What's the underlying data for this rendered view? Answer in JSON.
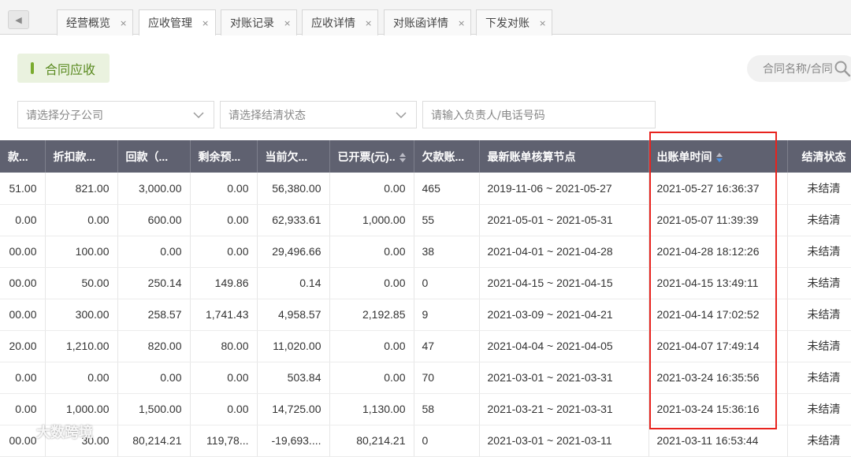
{
  "tabs": [
    {
      "label": "经营概览",
      "close": "×",
      "active": false
    },
    {
      "label": "应收管理",
      "close": "×",
      "active": true
    },
    {
      "label": "对账记录",
      "close": "×",
      "active": false
    },
    {
      "label": "应收详情",
      "close": "×",
      "active": false
    },
    {
      "label": "对账函详情",
      "close": "×",
      "active": false
    },
    {
      "label": "下发对账",
      "close": "×",
      "active": false
    }
  ],
  "section_button": {
    "label": "合同应收"
  },
  "search": {
    "placeholder": "合同名称/合同"
  },
  "filters": {
    "company": "请选择分子公司",
    "status": "请选择结清状态",
    "owner_placeholder": "请输入负责人/电话号码"
  },
  "table": {
    "headers": [
      "款...",
      "折扣款...",
      "回款（...",
      "剩余预...",
      "当前欠...",
      "已开票(元)..",
      "欠款账...",
      "最新账单核算节点",
      "出账单时间",
      "结清状态"
    ],
    "rows": [
      [
        "51.00",
        "821.00",
        "3,000.00",
        "0.00",
        "56,380.00",
        "0.00",
        "465",
        "2019-11-06 ~ 2021-05-27",
        "2021-05-27 16:36:37",
        "未结清"
      ],
      [
        "0.00",
        "0.00",
        "600.00",
        "0.00",
        "62,933.61",
        "1,000.00",
        "55",
        "2021-05-01 ~ 2021-05-31",
        "2021-05-07 11:39:39",
        "未结清"
      ],
      [
        "00.00",
        "100.00",
        "0.00",
        "0.00",
        "29,496.66",
        "0.00",
        "38",
        "2021-04-01 ~ 2021-04-28",
        "2021-04-28 18:12:26",
        "未结清"
      ],
      [
        "00.00",
        "50.00",
        "250.14",
        "149.86",
        "0.14",
        "0.00",
        "0",
        "2021-04-15 ~ 2021-04-15",
        "2021-04-15 13:49:11",
        "未结清"
      ],
      [
        "00.00",
        "300.00",
        "258.57",
        "1,741.43",
        "4,958.57",
        "2,192.85",
        "9",
        "2021-03-09 ~ 2021-04-21",
        "2021-04-14 17:02:52",
        "未结清"
      ],
      [
        "20.00",
        "1,210.00",
        "820.00",
        "80.00",
        "11,020.00",
        "0.00",
        "47",
        "2021-04-04 ~ 2021-04-05",
        "2021-04-07 17:49:14",
        "未结清"
      ],
      [
        "0.00",
        "0.00",
        "0.00",
        "0.00",
        "503.84",
        "0.00",
        "70",
        "2021-03-01 ~ 2021-03-31",
        "2021-03-24 16:35:56",
        "未结清"
      ],
      [
        "0.00",
        "1,000.00",
        "1,500.00",
        "0.00",
        "14,725.00",
        "1,130.00",
        "58",
        "2021-03-21 ~ 2021-03-31",
        "2021-03-24 15:36:16",
        "未结清"
      ],
      [
        "00.00",
        "30.00",
        "80,214.21",
        "119,78...",
        "-19,693....",
        "80,214.21",
        "0",
        "2021-03-01 ~ 2021-03-11",
        "2021-03-11 16:53:44",
        "未结清"
      ]
    ]
  },
  "watermark": {
    "text": "大数跨境"
  },
  "colors": {
    "header_bg": "#5f6170",
    "status_unsettled": "#e64c4c",
    "section_accent": "#7aab2e",
    "highlight": "#e8231e",
    "sort_asc": "#bcbcc6",
    "sort_desc": "#4a90e2"
  },
  "icons": [
    "back-arrow-icon",
    "close-icon",
    "search-icon",
    "chevron-down-icon",
    "sort-icon"
  ]
}
